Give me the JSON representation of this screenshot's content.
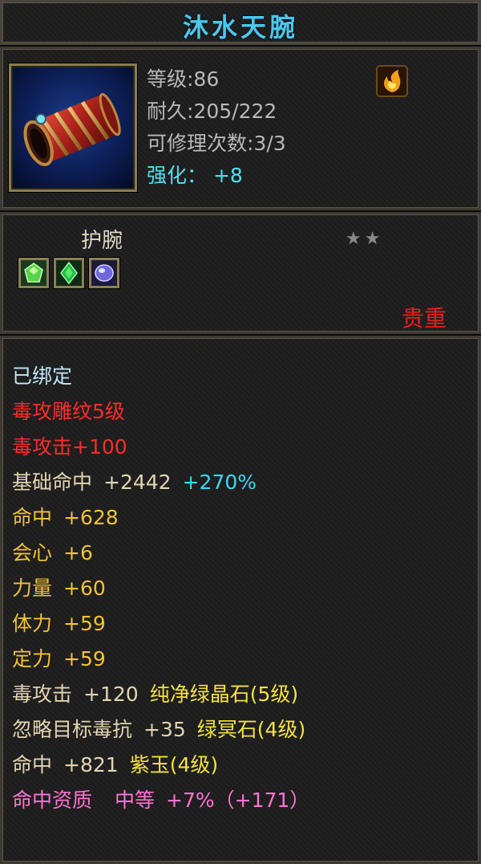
{
  "title": "沐水天腕",
  "header": {
    "level": "等级:86",
    "durability": "耐久:205/222",
    "repairs": "可修理次数:3/3",
    "upgrade_label": "强化：",
    "upgrade_value": "+8"
  },
  "item_type": "护腕",
  "grade_stars": "★★",
  "gems": [
    {
      "name": "green-crystal-gem",
      "color": "#3fbf3f"
    },
    {
      "name": "green-emerald-gem",
      "color": "#1fa83a"
    },
    {
      "name": "purple-jade-gem",
      "color": "#6a63d8"
    }
  ],
  "rarity": "贵重",
  "attributes": {
    "bound": "已绑定",
    "engraving": "毒攻雕纹5级",
    "poison_attack": "毒攻击+100",
    "base_hit_label": "基础命中",
    "base_hit_value": "+2442",
    "base_hit_percent": "+270%",
    "hit_label": "命中",
    "hit_value": "+628",
    "crit_label": "会心",
    "crit_value": "+6",
    "strength_label": "力量",
    "strength_value": "+60",
    "stamina_label": "体力",
    "stamina_value": "+59",
    "focus_label": "定力",
    "focus_value": "+59",
    "gem1_stat_label": "毒攻击",
    "gem1_stat_value": "+120",
    "gem1_name": "纯净绿晶石(5级)",
    "gem2_stat_label": "忽略目标毒抗",
    "gem2_stat_value": "+35",
    "gem2_name": "绿冥石(4级)",
    "gem3_stat_label": "命中",
    "gem3_stat_value": "+821",
    "gem3_name": "紫玉(4级)",
    "quality_label": "命中资质",
    "quality_grade": "中等",
    "quality_value": "+7%（+171）"
  }
}
